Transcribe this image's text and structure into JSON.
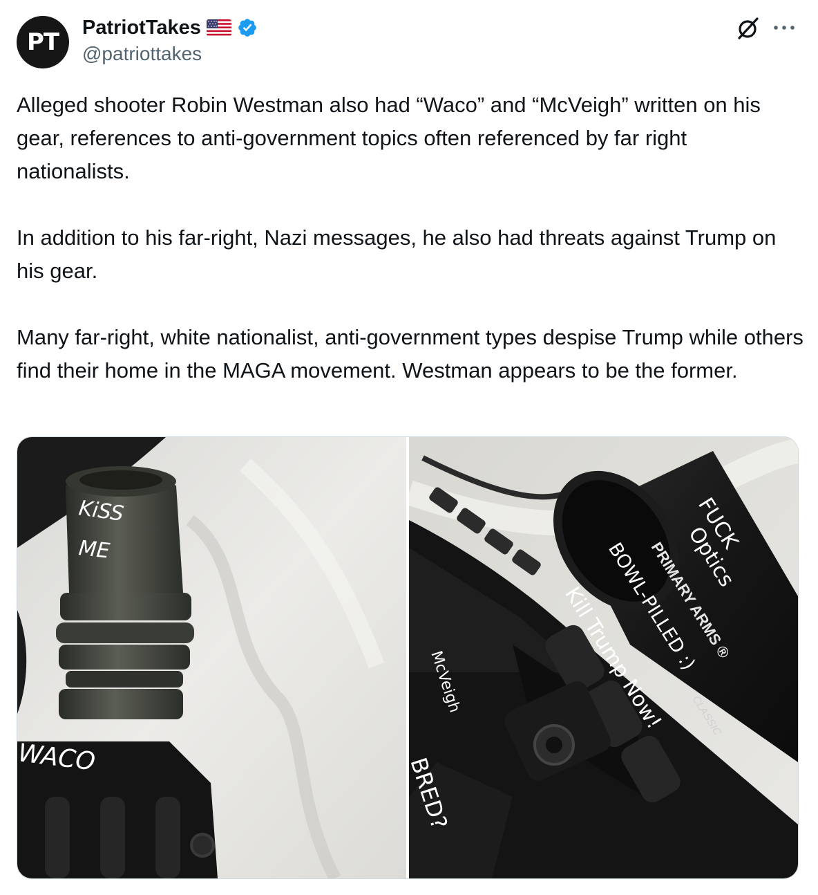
{
  "author": {
    "avatar_text": "PT",
    "display_name": "PatriotTakes",
    "flag_icon": "us-flag-icon",
    "verified_icon": "verified-badge-icon",
    "verified_color": "#1d9bf0",
    "handle": "@patriottakes"
  },
  "header_actions": {
    "grok_icon": "grok-icon",
    "more_icon": "more-horizontal-icon"
  },
  "tweet": {
    "paragraphs": [
      "Alleged shooter Robin Westman also had “Waco” and “McVeigh” written on his gear, references to anti-government topics often referenced by far right nationalists.",
      "In addition to his far-right, Nazi messages, he also had threats against Trump on his gear.",
      "Many far-right, white nationalist, anti-government types despise Trump while others find their home in the MAGA movement. Westman appears to be the former."
    ]
  },
  "media": {
    "left_photo": {
      "handwriting": [
        "KiSS",
        "ME",
        "WACO"
      ]
    },
    "right_photo": {
      "handwriting": [
        "FUCK",
        "Optics",
        "BOWL-PILLED :)",
        "Kill Trump Now!",
        "McVeigh",
        "BRED?"
      ],
      "printed_text": [
        "PRIMARY ARMS ®",
        "CLASSIC"
      ]
    }
  }
}
